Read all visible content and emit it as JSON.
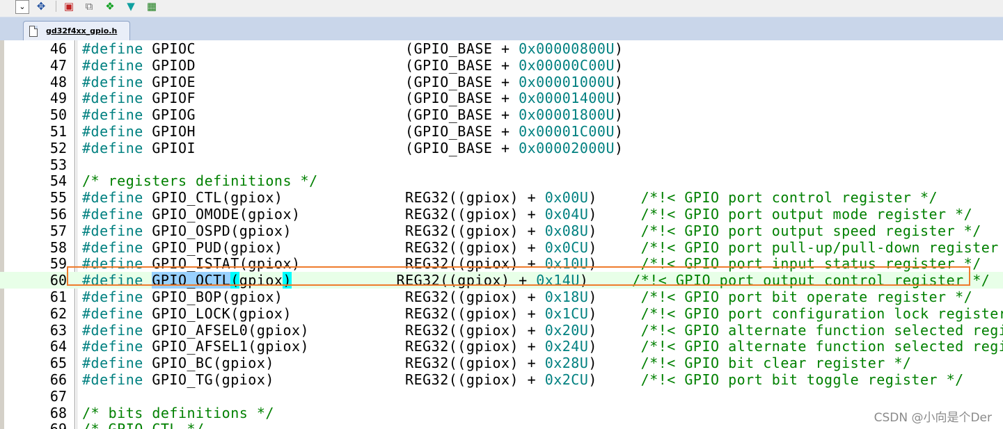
{
  "toolbar": {
    "icons": [
      "dropdown-arrow-icon",
      "magic-wand-icon",
      "component-icon",
      "copy-files-icon",
      "diamond-icon",
      "arrow-down-icon",
      "multi-project-icon"
    ]
  },
  "editor": {
    "active_file": "gd32f4xx_gpio.h",
    "current_line": 60,
    "lines": [
      {
        "n": "46",
        "parts": [
          [
            "kw",
            "#define"
          ],
          [
            "t",
            " GPIOC                        (GPIO_BASE + "
          ],
          [
            "hx",
            "0x00000800U"
          ],
          [
            "t",
            ")"
          ]
        ]
      },
      {
        "n": "47",
        "parts": [
          [
            "kw",
            "#define"
          ],
          [
            "t",
            " GPIOD                        (GPIO_BASE + "
          ],
          [
            "hx",
            "0x00000C00U"
          ],
          [
            "t",
            ")"
          ]
        ]
      },
      {
        "n": "48",
        "parts": [
          [
            "kw",
            "#define"
          ],
          [
            "t",
            " GPIOE                        (GPIO_BASE + "
          ],
          [
            "hx",
            "0x00001000U"
          ],
          [
            "t",
            ")"
          ]
        ]
      },
      {
        "n": "49",
        "parts": [
          [
            "kw",
            "#define"
          ],
          [
            "t",
            " GPIOF                        (GPIO_BASE + "
          ],
          [
            "hx",
            "0x00001400U"
          ],
          [
            "t",
            ")"
          ]
        ]
      },
      {
        "n": "50",
        "parts": [
          [
            "kw",
            "#define"
          ],
          [
            "t",
            " GPIOG                        (GPIO_BASE + "
          ],
          [
            "hx",
            "0x00001800U"
          ],
          [
            "t",
            ")"
          ]
        ]
      },
      {
        "n": "51",
        "parts": [
          [
            "kw",
            "#define"
          ],
          [
            "t",
            " GPIOH                        (GPIO_BASE + "
          ],
          [
            "hx",
            "0x00001C00U"
          ],
          [
            "t",
            ")"
          ]
        ]
      },
      {
        "n": "52",
        "parts": [
          [
            "kw",
            "#define"
          ],
          [
            "t",
            " GPIOI                        (GPIO_BASE + "
          ],
          [
            "hx",
            "0x00002000U"
          ],
          [
            "t",
            ")"
          ]
        ]
      },
      {
        "n": "53",
        "parts": []
      },
      {
        "n": "54",
        "parts": [
          [
            "cm",
            "/* registers definitions */"
          ]
        ]
      },
      {
        "n": "55",
        "parts": [
          [
            "kw",
            "#define"
          ],
          [
            "t",
            " GPIO_CTL(gpiox)              REG32((gpiox) + "
          ],
          [
            "hx",
            "0x00U"
          ],
          [
            "t",
            ")     "
          ],
          [
            "cm",
            "/*!< GPIO port control register */"
          ]
        ]
      },
      {
        "n": "56",
        "parts": [
          [
            "kw",
            "#define"
          ],
          [
            "t",
            " GPIO_OMODE(gpiox)            REG32((gpiox) + "
          ],
          [
            "hx",
            "0x04U"
          ],
          [
            "t",
            ")     "
          ],
          [
            "cm",
            "/*!< GPIO port output mode register */"
          ]
        ]
      },
      {
        "n": "57",
        "parts": [
          [
            "kw",
            "#define"
          ],
          [
            "t",
            " GPIO_OSPD(gpiox)             REG32((gpiox) + "
          ],
          [
            "hx",
            "0x08U"
          ],
          [
            "t",
            ")     "
          ],
          [
            "cm",
            "/*!< GPIO port output speed register */"
          ]
        ]
      },
      {
        "n": "58",
        "parts": [
          [
            "kw",
            "#define"
          ],
          [
            "t",
            " GPIO_PUD(gpiox)              REG32((gpiox) + "
          ],
          [
            "hx",
            "0x0CU"
          ],
          [
            "t",
            ")     "
          ],
          [
            "cm",
            "/*!< GPIO port pull-up/pull-down register */"
          ]
        ]
      },
      {
        "n": "59",
        "parts": [
          [
            "kw",
            "#define"
          ],
          [
            "t",
            " GPIO_ISTAT(gpiox)            REG32((gpiox) + "
          ],
          [
            "hx",
            "0x10U"
          ],
          [
            "t",
            ")     "
          ],
          [
            "cm",
            "/*!< GPIO port input status register */"
          ]
        ]
      },
      {
        "n": "60",
        "parts": [
          [
            "kw",
            "#define"
          ],
          [
            "t",
            " "
          ],
          [
            "sel",
            "GPIO_OCTL"
          ],
          [
            "br",
            "("
          ],
          [
            "t",
            "gpiox"
          ],
          [
            "br",
            ")"
          ],
          [
            "t",
            "            REG32((gpiox) + "
          ],
          [
            "hx",
            "0x14U"
          ],
          [
            "t",
            ")     "
          ],
          [
            "cm",
            "/*!< GPIO port output control register */"
          ]
        ]
      },
      {
        "n": "61",
        "parts": [
          [
            "kw",
            "#define"
          ],
          [
            "t",
            " GPIO_BOP(gpiox)              REG32((gpiox) + "
          ],
          [
            "hx",
            "0x18U"
          ],
          [
            "t",
            ")     "
          ],
          [
            "cm",
            "/*!< GPIO port bit operate register */"
          ]
        ]
      },
      {
        "n": "62",
        "parts": [
          [
            "kw",
            "#define"
          ],
          [
            "t",
            " GPIO_LOCK(gpiox)             REG32((gpiox) + "
          ],
          [
            "hx",
            "0x1CU"
          ],
          [
            "t",
            ")     "
          ],
          [
            "cm",
            "/*!< GPIO port configuration lock register */"
          ]
        ]
      },
      {
        "n": "63",
        "parts": [
          [
            "kw",
            "#define"
          ],
          [
            "t",
            " GPIO_AFSEL0(gpiox)           REG32((gpiox) + "
          ],
          [
            "hx",
            "0x20U"
          ],
          [
            "t",
            ")     "
          ],
          [
            "cm",
            "/*!< GPIO alternate function selected registe"
          ]
        ]
      },
      {
        "n": "64",
        "parts": [
          [
            "kw",
            "#define"
          ],
          [
            "t",
            " GPIO_AFSEL1(gpiox)           REG32((gpiox) + "
          ],
          [
            "hx",
            "0x24U"
          ],
          [
            "t",
            ")     "
          ],
          [
            "cm",
            "/*!< GPIO alternate function selected registe"
          ]
        ]
      },
      {
        "n": "65",
        "parts": [
          [
            "kw",
            "#define"
          ],
          [
            "t",
            " GPIO_BC(gpiox)               REG32((gpiox) + "
          ],
          [
            "hx",
            "0x28U"
          ],
          [
            "t",
            ")     "
          ],
          [
            "cm",
            "/*!< GPIO bit clear register */"
          ]
        ]
      },
      {
        "n": "66",
        "parts": [
          [
            "kw",
            "#define"
          ],
          [
            "t",
            " GPIO_TG(gpiox)               REG32((gpiox) + "
          ],
          [
            "hx",
            "0x2CU"
          ],
          [
            "t",
            ")     "
          ],
          [
            "cm",
            "/*!< GPIO port bit toggle register */"
          ]
        ]
      },
      {
        "n": "67",
        "parts": []
      },
      {
        "n": "68",
        "parts": [
          [
            "cm",
            "/* bits definitions */"
          ]
        ]
      },
      {
        "n": "69",
        "parts": [
          [
            "cm",
            "/* GPIO_CTL */"
          ]
        ]
      }
    ]
  },
  "watermark": "CSDN @小向是个Der",
  "colors": {
    "keyword": "#008080",
    "comment": "#008000",
    "highlight_box": "#ee7b2c",
    "selection": "#99d1ff",
    "brace_match": "#00ffff"
  }
}
